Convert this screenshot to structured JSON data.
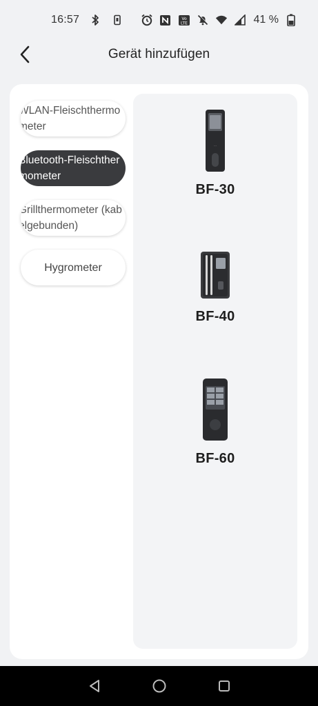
{
  "status_bar": {
    "time": "16:57",
    "left_icons": [
      "bluetooth-icon",
      "phone-small-icon"
    ],
    "right_icons": [
      "alarm-icon",
      "nfc-icon",
      "volte-icon",
      "mute-bell-icon",
      "wifi-icon",
      "signal-icon"
    ],
    "battery_percent": "41 %"
  },
  "header": {
    "title": "Gerät hinzufügen",
    "back_icon": "chevron-left-icon"
  },
  "categories": [
    {
      "label": "WLAN-Fleischthermometer",
      "active": false
    },
    {
      "label": "Bluetooth-Fleischthermometer",
      "active": true
    },
    {
      "label": "Grillthermometer (kabelgebunden)",
      "active": false
    },
    {
      "label": "Hygrometer",
      "active": false
    }
  ],
  "devices": [
    {
      "name": "BF-30",
      "icon": "thermometer-device-icon"
    },
    {
      "name": "BF-40",
      "icon": "thermometer-case-icon"
    },
    {
      "name": "BF-60",
      "icon": "thermometer-display-icon"
    }
  ],
  "nav_bar": {
    "icons": [
      "back-triangle-icon",
      "home-circle-icon",
      "recents-square-icon"
    ]
  },
  "colors": {
    "background": "#f1f2f4",
    "active_pill": "#3a3b3e",
    "panel": "#f3f4f6"
  }
}
